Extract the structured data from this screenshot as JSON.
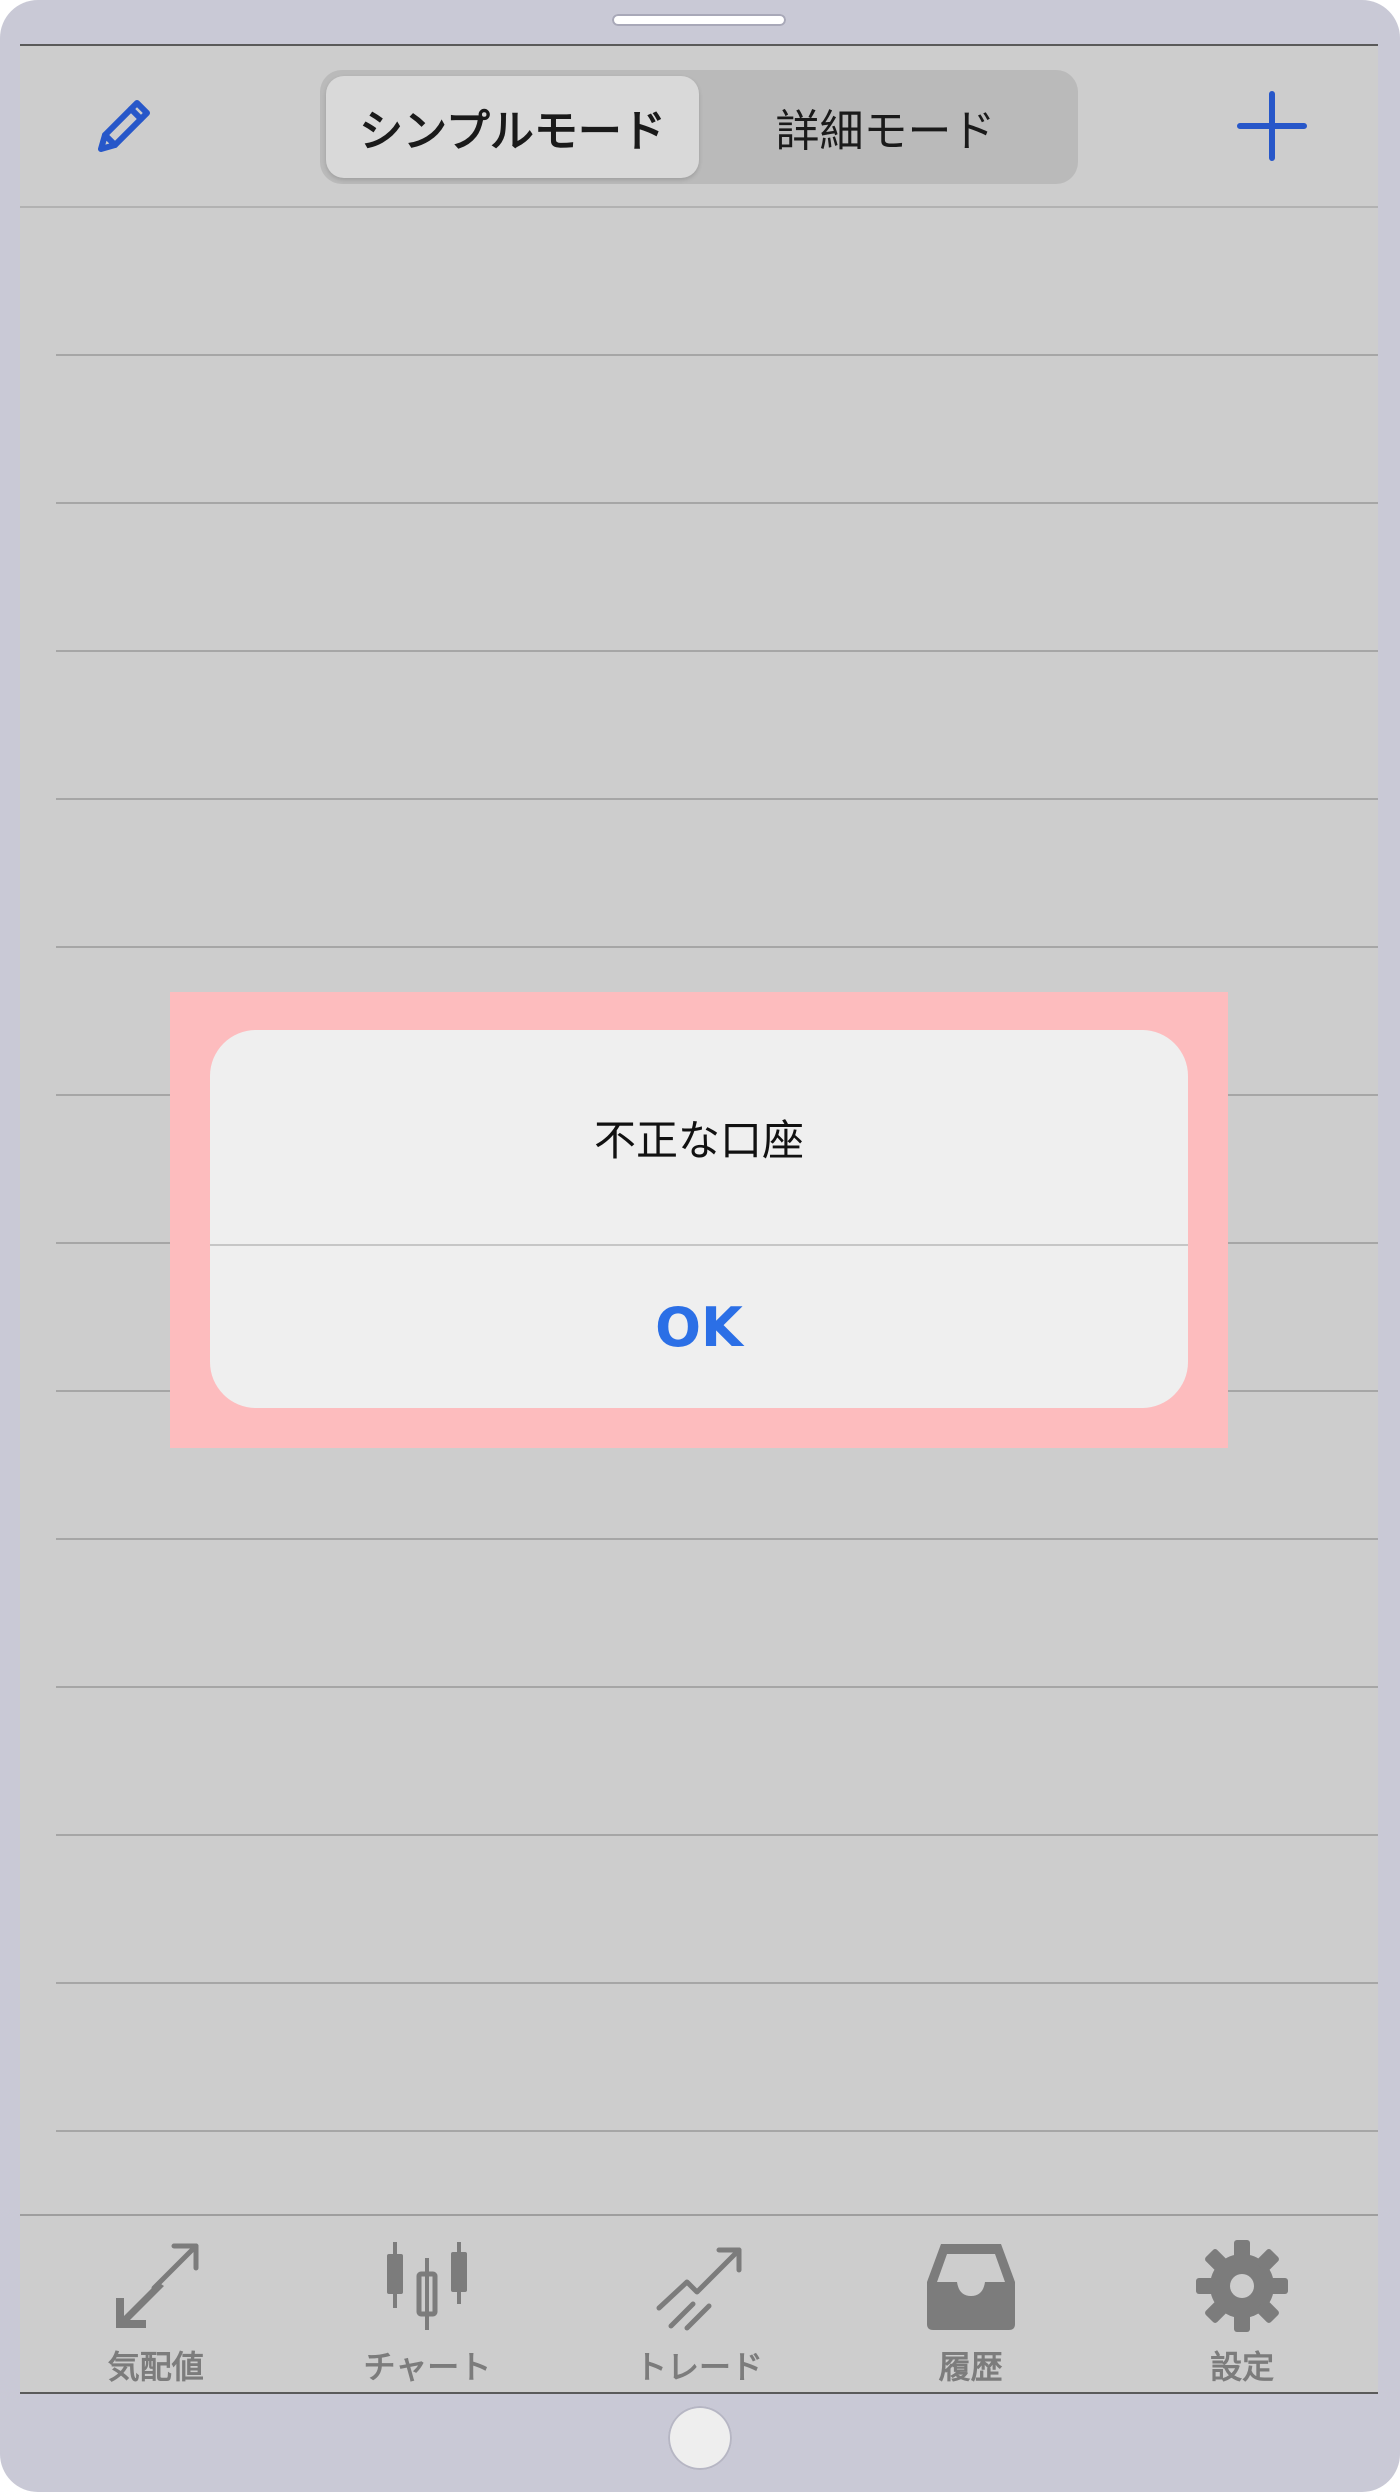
{
  "colors": {
    "accent": "#2b6fe6",
    "nav_icon": "#2757c9",
    "tab_inactive": "#7c7c7c",
    "highlight": "#fdbcbe"
  },
  "navbar": {
    "left_icon": "pencil-icon",
    "right_icon": "plus-icon",
    "segments": [
      {
        "label": "シンプルモード",
        "selected": true
      },
      {
        "label": "詳細モード",
        "selected": false
      }
    ]
  },
  "alert": {
    "message": "不正な口座",
    "ok_label": "OK"
  },
  "tabbar": {
    "tabs": [
      {
        "label": "気配値",
        "icon": "quotes-arrows-icon"
      },
      {
        "label": "チャート",
        "icon": "candlestick-icon"
      },
      {
        "label": "トレード",
        "icon": "trade-icon"
      },
      {
        "label": "履歴",
        "icon": "inbox-tray-icon"
      },
      {
        "label": "設定",
        "icon": "gear-icon"
      }
    ]
  }
}
